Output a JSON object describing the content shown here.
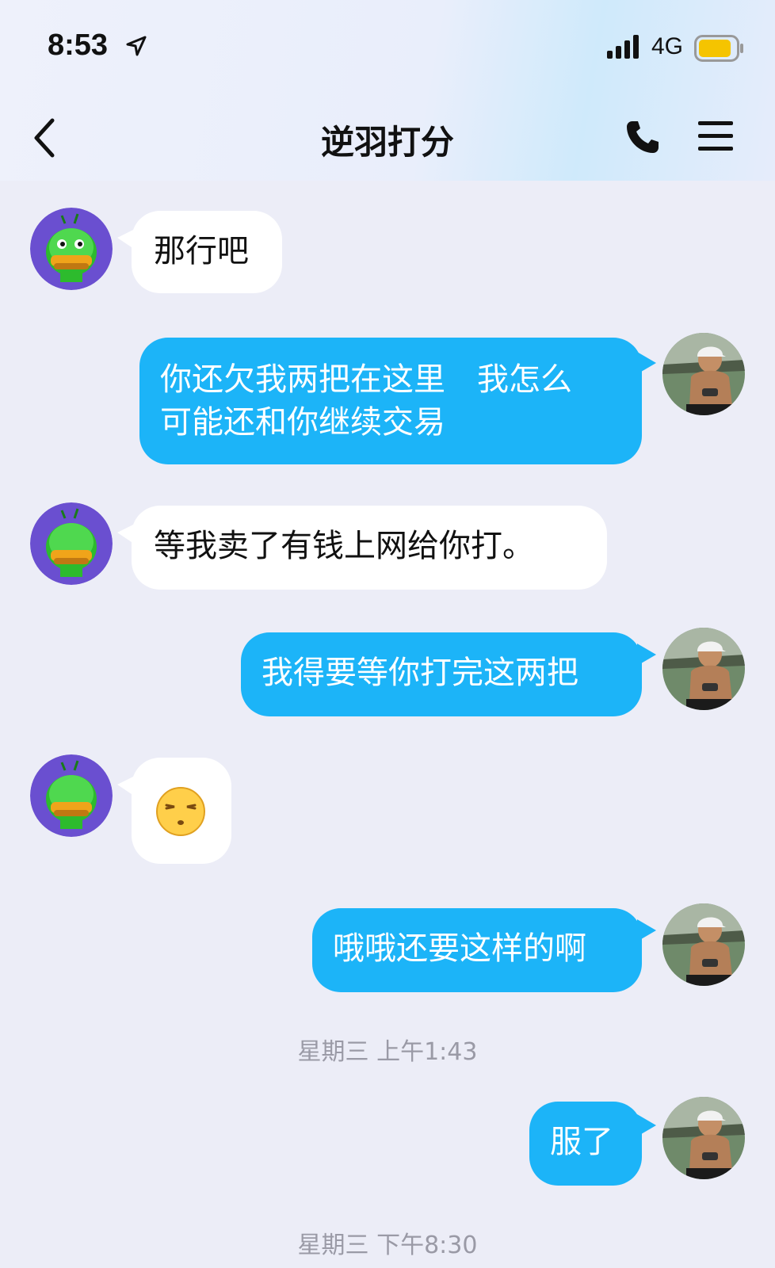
{
  "status_bar": {
    "time": "8:53",
    "network": "4G"
  },
  "header": {
    "title": "逆羽打分"
  },
  "messages": [
    {
      "side": "in",
      "text": "那行吧"
    },
    {
      "side": "out",
      "line1": "你还欠我两把在这里　我怎么",
      "line2": "可能还和你继续交易"
    },
    {
      "side": "in",
      "text": "等我卖了有钱上网给你打。"
    },
    {
      "side": "out",
      "text": "我得要等你打完这两把"
    },
    {
      "side": "in",
      "emoji": "😒"
    },
    {
      "side": "out",
      "text": "哦哦还要这样的啊"
    },
    {
      "side": "out",
      "text": "服了"
    }
  ],
  "timestamps": [
    "星期三 上午1:43",
    "星期三 下午8:30"
  ],
  "colors": {
    "outgoing_bubble": "#1cb4f8",
    "incoming_bubble": "#ffffff",
    "background": "#ecedf7"
  }
}
